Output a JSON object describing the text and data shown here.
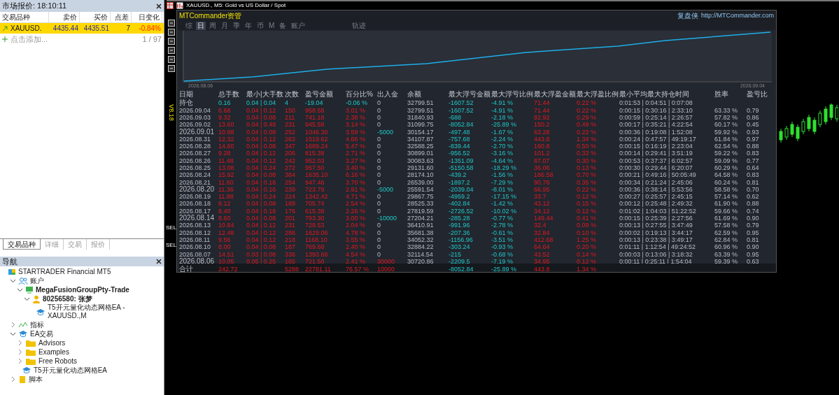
{
  "market_watch": {
    "title": "市场报价: 18:10:11",
    "columns": [
      "交易品种",
      "卖价",
      "买价",
      "点差",
      "日变化"
    ],
    "rows": [
      {
        "symbol": "XAUUSD.",
        "bid": "4435.44",
        "ask": "4435.51",
        "spread": "7",
        "change": "-0.84%",
        "kind": "falling",
        "selected": true
      }
    ],
    "add_label": "点击添加...",
    "count": "1 / 97",
    "tabs": [
      {
        "label": "交易品种",
        "selected": true
      },
      {
        "label": "详细",
        "selected": false
      },
      {
        "label": "交易",
        "selected": false
      },
      {
        "label": "报价",
        "selected": false
      }
    ]
  },
  "navigator": {
    "title": "导航",
    "items": [
      {
        "label": "STARTRADER Financial MT5",
        "kind": "broker",
        "children": [
          {
            "label": "账户",
            "kind": "accounts",
            "expanded": true,
            "children": [
              {
                "label": "MegaFusionGroupPty-Trade",
                "kind": "server",
                "expanded": true,
                "children": [
                  {
                    "label": "80256580: 张梦",
                    "kind": "user",
                    "expanded": true,
                    "children": [
                      {
                        "label": "T5开元量化动态网格EA - XAUUSD.,M",
                        "kind": "ea"
                      }
                    ]
                  }
                ]
              }
            ]
          },
          {
            "label": "指标",
            "kind": "indicators",
            "expanded": false
          },
          {
            "label": "EA交易",
            "kind": "ea",
            "expanded": true,
            "children": [
              {
                "label": "Advisors",
                "kind": "folder",
                "expanded": false
              },
              {
                "label": "Examples",
                "kind": "folder",
                "expanded": false
              },
              {
                "label": "Free Robots",
                "kind": "folder",
                "expanded": false
              },
              {
                "label": "T5开元量化动态网格EA",
                "kind": "ea"
              }
            ]
          },
          {
            "label": "脚本",
            "kind": "script",
            "expanded": false
          }
        ]
      }
    ]
  },
  "chart_window": {
    "title": "XAUUSD., M5:  Gold vs US Dollar / Spot",
    "side_labels": [
      "SEL",
      "SEL"
    ]
  },
  "panel": {
    "brand": "MTCommander资管",
    "site_name": "复盘侠",
    "site_url": "http://MTCommander.com",
    "version": "V8.18",
    "tabs": [
      {
        "label": "综",
        "selected": false
      },
      {
        "label": "日",
        "selected": true
      },
      {
        "label": "周",
        "selected": false
      },
      {
        "label": "月",
        "selected": false
      },
      {
        "label": "季",
        "selected": false
      },
      {
        "label": "年",
        "selected": false
      },
      {
        "label": "币",
        "selected": false
      },
      {
        "label": "M",
        "selected": false
      },
      {
        "label": "备",
        "selected": false
      },
      {
        "label": "账户",
        "selected": false
      },
      {
        "label": "轨迹",
        "selected": false
      }
    ],
    "equity_start": "2026.08.06",
    "equity_end": "2026.09.04",
    "columns": [
      "日期",
      "总手数",
      "最小|大手数",
      "次数",
      "盈亏金额",
      "百分比%",
      "出入金",
      "余额",
      "最大浮亏金额",
      "最大浮亏比例",
      "最大浮盈金额",
      "最大浮盈比例",
      "最小平均最大持仓时间",
      "胜率",
      "盈亏比"
    ],
    "rows": [
      {
        "kind": "position",
        "cells": [
          "持仓",
          "0.16",
          "0.04 | 0.04",
          "4",
          "-19.04",
          "-0.06 %",
          "0",
          "32799.51",
          "-1607.52",
          "-4.91 %",
          "71.44",
          "0.22 %",
          "0:01:53 | 0:04:51 | 0:07:08",
          null,
          null
        ]
      },
      {
        "kind": "day",
        "cells": [
          "2026.09.04",
          "6.68",
          "0.04 | 0.12",
          "150",
          "958.58",
          "3.01 %",
          "0",
          "32799.51",
          "-1607.52",
          "-4.91 %",
          "71.44",
          "0.22 %",
          "0:00:15 | 0:30:16 | 2:33:10",
          "63.33 %",
          "0.79"
        ]
      },
      {
        "kind": "day",
        "cells": [
          "2026.09.03",
          "9.32",
          "0.04 | 0.08",
          "211",
          "741.18",
          "2.38 %",
          "0",
          "31840.93",
          "-688",
          "-2.18 %",
          "92.92",
          "0.29 %",
          "0:00:59 | 0:25:14 | 2:26:57",
          "57.82 %",
          "0.86"
        ]
      },
      {
        "kind": "day",
        "cells": [
          "2026.09.02",
          "13.60",
          "0.04 | 0.48",
          "231",
          "945.58",
          "3.14 %",
          "0",
          "31099.75",
          "-8052.84",
          "-25.89 %",
          "150.2",
          "0.49 %",
          "0:00:17 | 0:35:21 | 4:22:54",
          "60.17 %",
          "0.45"
        ]
      },
      {
        "kind": "withdrawal",
        "cells": [
          "2026.09.01",
          "10.88",
          "0.04 | 0.08",
          "252",
          "1046.30",
          "3.59 %",
          "-5000",
          "30154.17",
          "-497.48",
          "-1.67 %",
          "63.28",
          "0.22 %",
          "0:00:36 | 0:19:08 | 1:52:08",
          "59.92 %",
          "0.93"
        ]
      },
      {
        "kind": "day",
        "cells": [
          "2026.08.31",
          "12.32",
          "0.04 | 0.12",
          "283",
          "1519.62",
          "4.66 %",
          "0",
          "34107.87",
          "-757.68",
          "-2.24 %",
          "443.8",
          "1.34 %",
          "0:00:24 | 0:47:57 | 49:19:17",
          "61.84 %",
          "0.97"
        ]
      },
      {
        "kind": "day",
        "cells": [
          "2026.08.28",
          "14.60",
          "0.04 | 0.08",
          "347",
          "1689.24",
          "5.47 %",
          "0",
          "32588.25",
          "-839.44",
          "-2.70 %",
          "160.8",
          "0.50 %",
          "0:00:15 | 0:16:19 | 2:23:04",
          "62.54 %",
          "0.88"
        ]
      },
      {
        "kind": "day",
        "cells": [
          "2026.08.27",
          "9.28",
          "0.04 | 0.12",
          "206",
          "815.38",
          "2.71 %",
          "0",
          "30899.01",
          "-956.52",
          "-3.16 %",
          "101.2",
          "0.33 %",
          "0:00:14 | 0:29:41 | 3:51:19",
          "59.22 %",
          "0.83"
        ]
      },
      {
        "kind": "day",
        "cells": [
          "2026.08.26",
          "11.48",
          "0.04 | 0.12",
          "242",
          "952.03",
          "3.27 %",
          "0",
          "30083.63",
          "-1351.09",
          "-4.64 %",
          "87.07",
          "0.30 %",
          "0:00:53 | 0:37:37 | 6:02:57",
          "59.09 %",
          "0.77"
        ]
      },
      {
        "kind": "day",
        "cells": [
          "2026.08.25",
          "13.08",
          "0.04 | 0.24",
          "272",
          "957.50",
          "3.40 %",
          "0",
          "29131.60",
          "-5150.58",
          "-18.29 %",
          "36.06",
          "0.13 %",
          "0:00:30 | 0:29:44 | 6:20:07",
          "60.29 %",
          "0.64"
        ]
      },
      {
        "kind": "day",
        "cells": [
          "2026.08.24",
          "15.92",
          "0.04 | 0.08",
          "384",
          "1635.10",
          "6.16 %",
          "0",
          "28174.10",
          "-439.2",
          "-1.56 %",
          "186.58",
          "0.70 %",
          "0:00:21 | 0:49:16 | 50:05:49",
          "64.58 %",
          "0.83"
        ]
      },
      {
        "kind": "day",
        "cells": [
          "2026.08.21",
          "11.60",
          "0.04 | 0.16",
          "254",
          "947.46",
          "3.70 %",
          "0",
          "26539.00",
          "-1897.2",
          "-7.29 %",
          "90.76",
          "0.35 %",
          "0:00:34 | 0:21:24 | 2:45:06",
          "60.24 %",
          "0.81"
        ]
      },
      {
        "kind": "withdrawal",
        "cells": [
          "2026.08.20",
          "11.36",
          "0.04 | 0.16",
          "239",
          "723.79",
          "2.91 %",
          "-5000",
          "25591.54",
          "-2039.04",
          "-8.01 %",
          "66.95",
          "0.22 %",
          "0:00:36 | 0:38:14 | 5:53:56",
          "58.58 %",
          "0.70"
        ]
      },
      {
        "kind": "day",
        "cells": [
          "2026.08.19",
          "11.88",
          "0.04 | 0.24",
          "224",
          "1342.42",
          "4.71 %",
          "0",
          "29867.75",
          "-4959.2",
          "-17.15 %",
          "33.7",
          "0.12 %",
          "0:00:27 | 0:25:57 | 2:45:15",
          "57.14 %",
          "0.62"
        ]
      },
      {
        "kind": "day",
        "cells": [
          "2026.08.18",
          "8.12",
          "0.04 | 0.08",
          "189",
          "705.74",
          "2.54 %",
          "0",
          "28525.33",
          "-402.84",
          "-1.42 %",
          "43.12",
          "0.15 %",
          "0:00:12 | 0:25:48 | 2:49:32",
          "61.90 %",
          "0.88"
        ]
      },
      {
        "kind": "day",
        "cells": [
          "2026.08.17",
          "8.40",
          "0.04 | 0.16",
          "176",
          "615.38",
          "2.26 %",
          "0",
          "27819.59",
          "-2726.52",
          "-10.02 %",
          "34.12",
          "0.12 %",
          "0:01:02 | 1:04:03 | 51:22:52",
          "59.66 %",
          "0.74"
        ]
      },
      {
        "kind": "withdrawal",
        "cells": [
          "2026.08.14",
          "8.60",
          "0.04 | 0.08",
          "201",
          "793.30",
          "3.00 %",
          "-10000",
          "27204.21",
          "-285.28",
          "-0.77 %",
          "149.44",
          "0.41 %",
          "0:00:15 | 0:25:39 | 2:27:56",
          "61.69 %",
          "0.90"
        ]
      },
      {
        "kind": "day",
        "cells": [
          "2026.08.13",
          "10.84",
          "0.04 | 0.12",
          "231",
          "729.53",
          "2.04 %",
          "0",
          "36410.91",
          "-991.96",
          "-2.78 %",
          "32.4",
          "0.09 %",
          "0:00:13 | 0:27:55 | 3:47:49",
          "57.58 %",
          "0.79"
        ]
      },
      {
        "kind": "day",
        "cells": [
          "2026.08.12",
          "12.48",
          "0.04 | 0.12",
          "286",
          "1629.06",
          "4.78 %",
          "0",
          "35681.38",
          "-207.36",
          "-0.61 %",
          "32.84",
          "0.10 %",
          "0:00:02 | 0:19:13 | 3:44:17",
          "62.59 %",
          "0.95"
        ]
      },
      {
        "kind": "day",
        "cells": [
          "2026.08.11",
          "9.56",
          "0.04 | 0.12",
          "218",
          "1168.10",
          "3.55 %",
          "0",
          "34052.32",
          "-1156.96",
          "-3.51 %",
          "412.68",
          "1.25 %",
          "0:00:13 | 0:23:38 | 3:49:17",
          "62.84 %",
          "0.81"
        ]
      },
      {
        "kind": "day",
        "cells": [
          "2026.08.10",
          "8.00",
          "0.04 | 0.08",
          "187",
          "769.68",
          "2.40 %",
          "0",
          "32884.22",
          "-303.24",
          "-0.93 %",
          "64.64",
          "0.20 %",
          "0:01:11 | 1:12:54 | 49:24:52",
          "60.96 %",
          "0.90"
        ]
      },
      {
        "kind": "day",
        "cells": [
          "2026.08.07",
          "14.51",
          "0.03 | 0.08",
          "336",
          "1393.68",
          "4.54 %",
          "0",
          "32114.54",
          "-215",
          "-0.68 %",
          "43.52",
          "0.14 %",
          "0:00:03 | 0:13:06 | 3:18:32",
          "63.39 %",
          "0.95"
        ]
      },
      {
        "kind": "deposit",
        "cells": [
          "2026.08.06",
          "10.05",
          "0.05 | 0.25",
          "165",
          "721.50",
          "2.41 %",
          "30000",
          "30720.86",
          "-2209.5",
          "-7.19 %",
          "34.95",
          "0.12 %",
          "0:00:11 | 0:25:11 | 1:54:04",
          "59.39 %",
          "0.63"
        ]
      },
      {
        "kind": "total",
        "cells": [
          "合计",
          "242.72",
          null,
          "5288",
          "22781.11",
          "76.57 %",
          "10000",
          null,
          "-8052.84",
          "-25.89 %",
          "443.8",
          "1.34 %",
          null,
          null,
          null
        ]
      }
    ]
  }
}
